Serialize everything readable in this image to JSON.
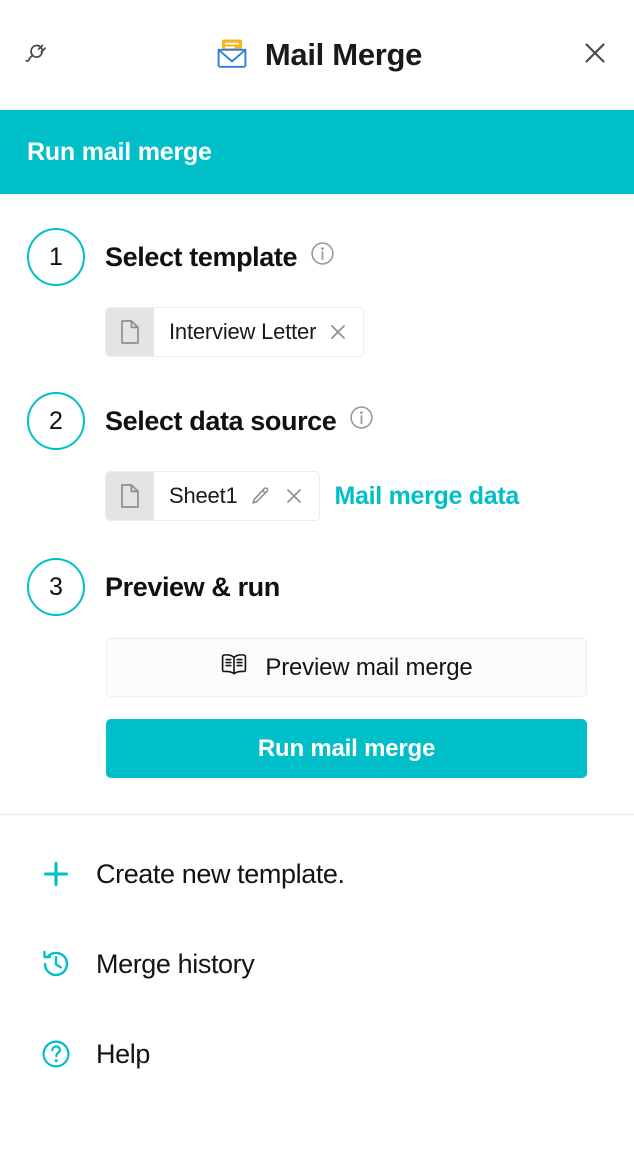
{
  "header": {
    "title": "Mail Merge",
    "logo_icon": "envelope-letter-icon",
    "plug_icon": "plug-icon",
    "close_icon": "close-icon"
  },
  "section_bar": {
    "title": "Run mail merge"
  },
  "steps": [
    {
      "number": "1",
      "title": "Select template",
      "info_icon": "info-icon",
      "chip": {
        "icon": "document-icon",
        "label": "Interview Letter",
        "actions": [
          "close-icon"
        ]
      },
      "link": null
    },
    {
      "number": "2",
      "title": "Select data source",
      "info_icon": "info-icon",
      "chip": {
        "icon": "document-icon",
        "label": "Sheet1",
        "actions": [
          "pencil-icon",
          "close-icon"
        ]
      },
      "link": "Mail merge data"
    },
    {
      "number": "3",
      "title": "Preview & run",
      "info_icon": null,
      "chip": null,
      "link": null
    }
  ],
  "actions": {
    "preview_label": "Preview mail merge",
    "preview_icon": "open-book-icon",
    "run_label": "Run mail merge"
  },
  "menu": [
    {
      "label": "Create new template.",
      "icon": "plus-icon"
    },
    {
      "label": "Merge history",
      "icon": "history-clock-icon"
    },
    {
      "label": "Help",
      "icon": "question-circle-icon"
    }
  ],
  "colors": {
    "accent": "#00bfc8",
    "logo_yellow": "#f7b517",
    "logo_blue": "#2f7fd8",
    "chip_icon_bg": "#e4e4e4",
    "text": "#141414"
  }
}
